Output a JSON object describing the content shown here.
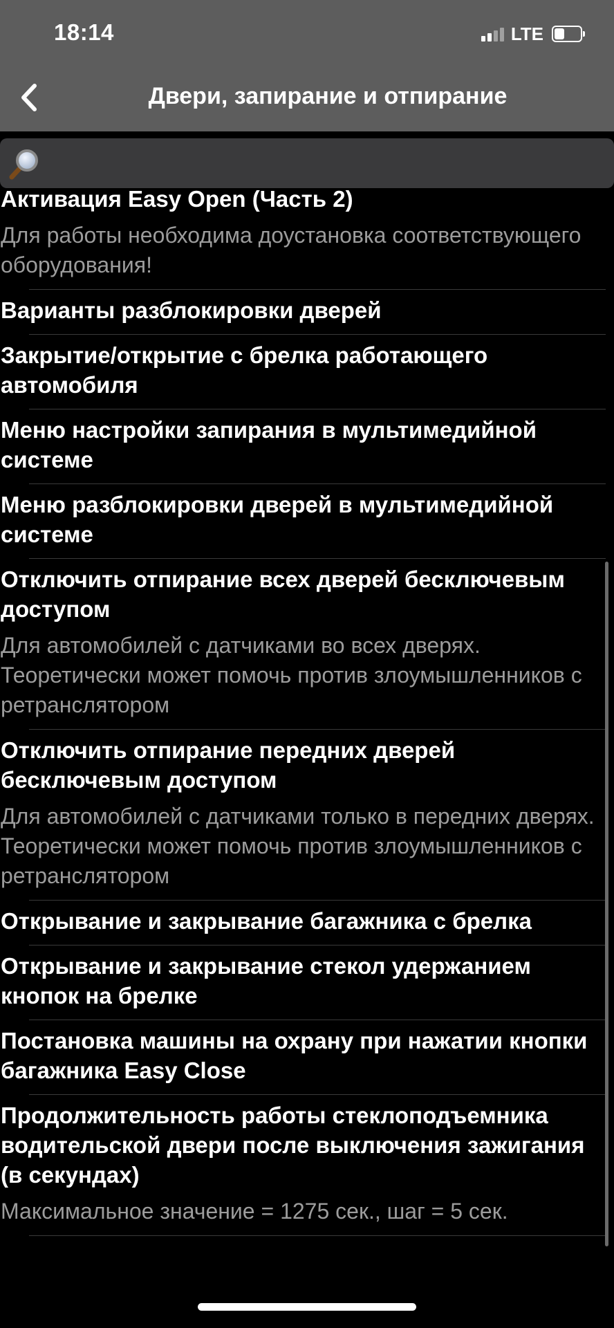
{
  "status_bar": {
    "time": "18:14",
    "network": "LTE",
    "battery_level": 0.45
  },
  "header": {
    "back_icon": "chevron-left-icon",
    "title": "Двери, запирание и отпирание"
  },
  "search": {
    "icon": "search-icon",
    "value": "",
    "placeholder": ""
  },
  "items": [
    {
      "title": "Активация Easy Open (Часть 2)",
      "description": "Для работы необходима доустановка соответствующего оборудования!"
    },
    {
      "title": "Варианты разблокировки дверей",
      "description": ""
    },
    {
      "title": "Закрытие/открытие с брелка работающего автомобиля",
      "description": ""
    },
    {
      "title": "Меню настройки запирания в мультимедийной системе",
      "description": ""
    },
    {
      "title": "Меню разблокировки дверей в мультимедийной системе",
      "description": ""
    },
    {
      "title": "Отключить отпирание всех дверей бесключевым доступом",
      "description": "Для автомобилей с датчиками во всех дверях. Теоретически может помочь против злоумышленников с ретранслятором"
    },
    {
      "title": "Отключить отпирание передних дверей бесключевым доступом",
      "description": "Для автомобилей с датчиками только в передних дверях. Теоретически может помочь против злоумышленников с ретранслятором"
    },
    {
      "title": "Открывание и закрывание багажника с брелка",
      "description": ""
    },
    {
      "title": "Открывание и закрывание стекол удержанием кнопок на брелке",
      "description": ""
    },
    {
      "title": "Постановка машины на охрану при нажатии кнопки багажника Easy Close",
      "description": ""
    },
    {
      "title": "Продолжительность работы стеклоподъемника водительской двери после выключения зажигания (в секундах)",
      "description": "Максимальное значение = 1275 сек., шаг = 5 сек."
    }
  ],
  "colors": {
    "header_bg": "#5d5d5d",
    "background": "#000000",
    "search_bg": "#3a3a3c",
    "title_text": "#ffffff",
    "description_text": "#9c9c9c"
  }
}
